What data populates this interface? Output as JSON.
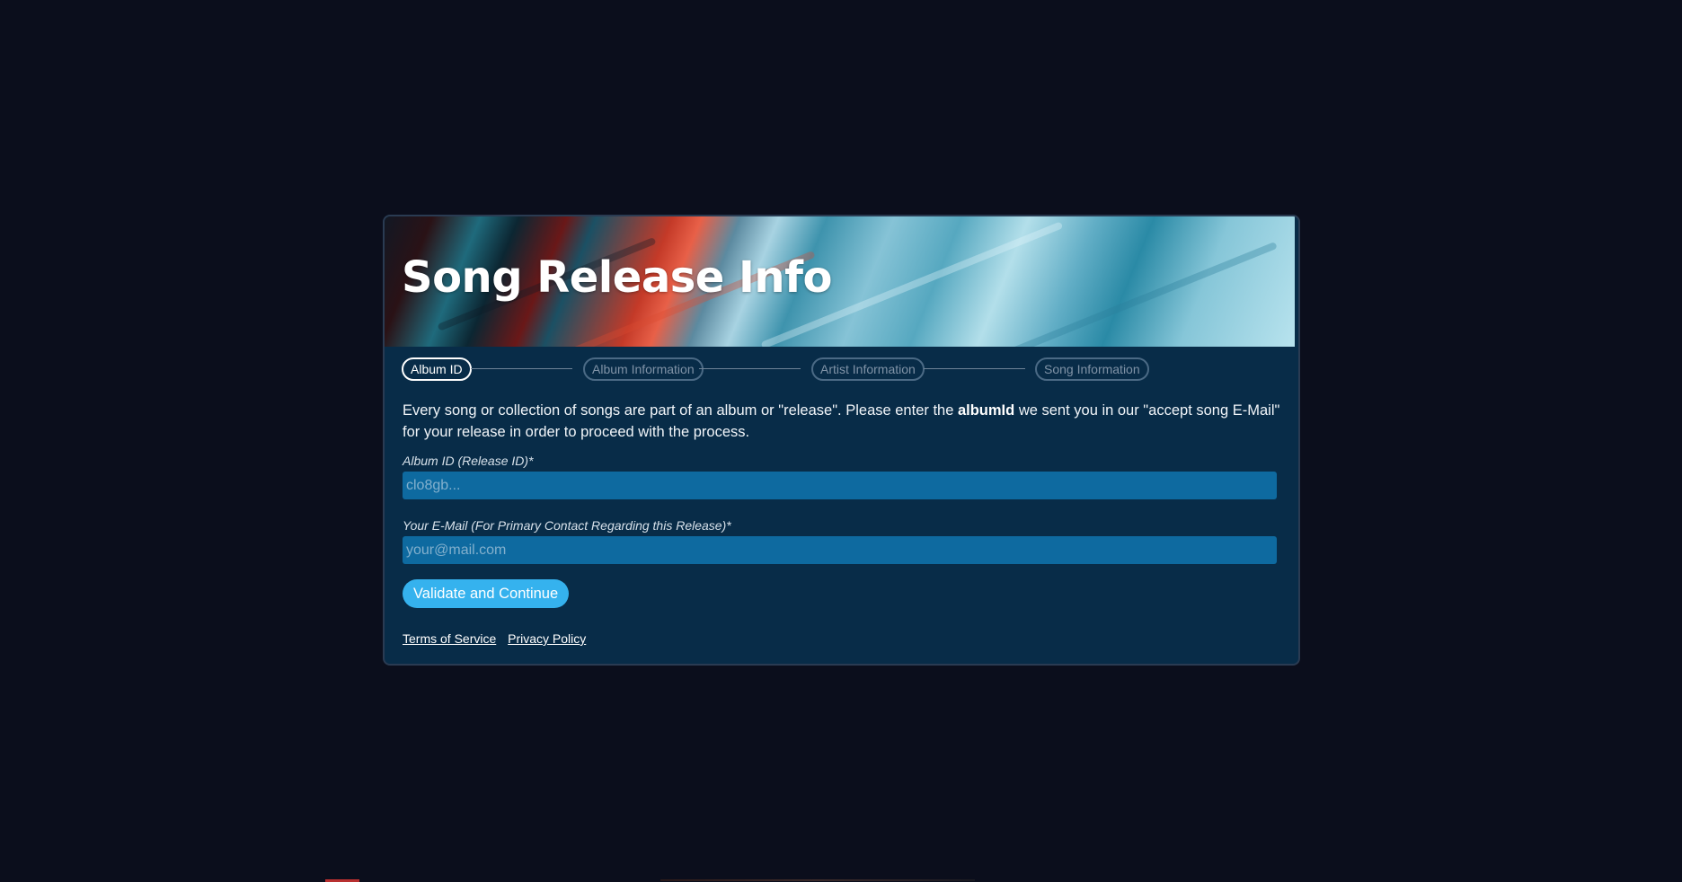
{
  "card": {
    "title": "Song Release Info"
  },
  "steps": [
    {
      "label": "Album ID",
      "state": "active"
    },
    {
      "label": "Album Information",
      "state": "inactive"
    },
    {
      "label": "Artist Information",
      "state": "inactive"
    },
    {
      "label": "Song Information",
      "state": "inactive"
    }
  ],
  "intro": {
    "before": "Every song or collection of songs are part of an album or \"release\". Please enter the ",
    "bold": "albumId",
    "after": " we sent you in our \"accept song E-Mail\" for your release in order to proceed with the process."
  },
  "form": {
    "album_id": {
      "label": "Album ID (Release ID)*",
      "placeholder": "clo8gb...",
      "value": ""
    },
    "email": {
      "label": "Your E-Mail (For Primary Contact Regarding this Release)*",
      "placeholder": "your@mail.com",
      "value": ""
    },
    "submit_label": "Validate and Continue"
  },
  "footer": {
    "terms_label": "Terms of Service",
    "privacy_label": "Privacy Policy"
  },
  "colors": {
    "page_background": "#0b0e1c",
    "card_background": "#082c48",
    "input_background": "#0e6aa0",
    "button_background": "#35b2ee"
  }
}
